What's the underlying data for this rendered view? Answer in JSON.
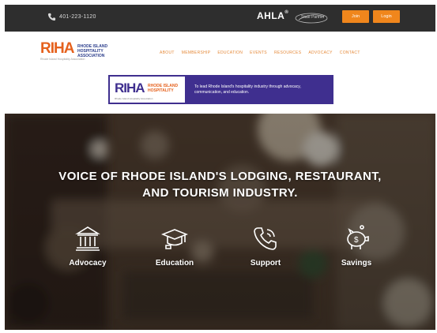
{
  "topbar": {
    "phone": "401-223-1120",
    "phone_icon": "phone-icon",
    "ahla": "AHLA",
    "ahla_mark": "®",
    "partner_text": "State Partner",
    "join_label": "Join",
    "login_label": "Login"
  },
  "header": {
    "logo_mark": "RIHA",
    "logo_sub_1": "RHODE ISLAND",
    "logo_sub_2": "HOSPITALITY",
    "logo_sub_3": "ASSOCIATION",
    "logo_tagline": "Rhode Island Hospitality Association",
    "nav": [
      "ABOUT",
      "MEMBERSHIP",
      "EDUCATION",
      "EVENTS",
      "RESOURCES",
      "ADVOCACY",
      "CONTACT"
    ]
  },
  "banner": {
    "logo_mark": "RIHA",
    "logo_sub_1": "RHODE ISLAND",
    "logo_sub_2": "HOSPITALITY",
    "logo_caption": "Rhode Island Hospitality Association",
    "text": "To lead Rhode Island's hospitality industry through advocacy, communication, and education."
  },
  "hero": {
    "headline_1": "VOICE OF RHODE ISLAND'S LODGING, RESTAURANT,",
    "headline_2": "AND TOURISM INDUSTRY.",
    "features": [
      {
        "label": "Advocacy",
        "icon": "capitol-building-icon"
      },
      {
        "label": "Education",
        "icon": "graduation-cap-icon"
      },
      {
        "label": "Support",
        "icon": "phone-handset-icon"
      },
      {
        "label": "Savings",
        "icon": "piggy-bank-icon"
      }
    ]
  },
  "colors": {
    "accent_orange": "#f0861c",
    "topbar_bg": "#2e2e2e",
    "banner_purple": "#3f2f8f",
    "logo_orange": "#e5611d"
  }
}
